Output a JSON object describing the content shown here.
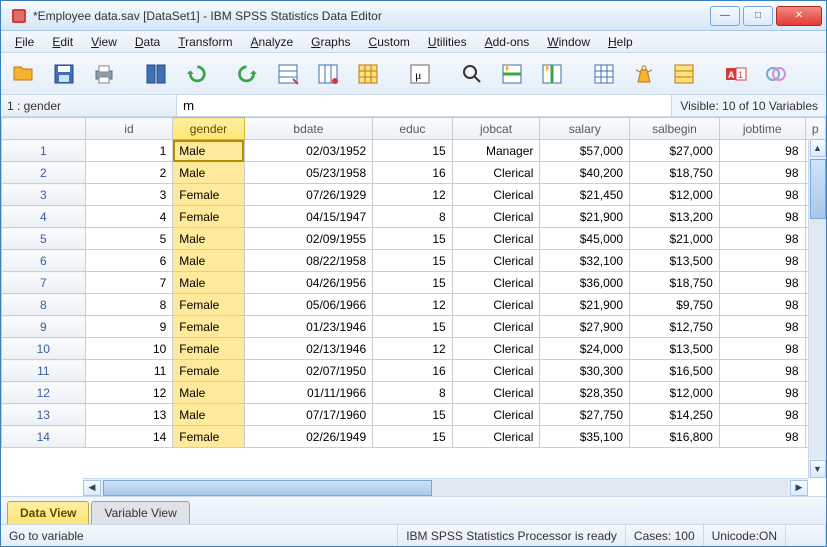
{
  "window": {
    "title": "*Employee data.sav [DataSet1] - IBM SPSS Statistics Data Editor"
  },
  "menu": [
    "File",
    "Edit",
    "View",
    "Data",
    "Transform",
    "Analyze",
    "Graphs",
    "Custom",
    "Utilities",
    "Add-ons",
    "Window",
    "Help"
  ],
  "toolbar_icons": [
    "open",
    "save",
    "print",
    "recall",
    "undo",
    "redo",
    "gotocase",
    "gotovariable",
    "variables",
    "run",
    "find",
    "insertcase",
    "insertvariable",
    "splitfile",
    "weight",
    "selectcases",
    "valuelabels",
    "usevarsets"
  ],
  "editbar": {
    "cellref": "1 : gender",
    "value": "m",
    "visible_label": "Visible: 10 of 10 Variables"
  },
  "grid": {
    "columns": [
      "id",
      "gender",
      "bdate",
      "educ",
      "jobcat",
      "salary",
      "salbegin",
      "jobtime",
      "p"
    ],
    "selected_column": "gender",
    "rows": [
      {
        "n": 1,
        "id": "1",
        "gender": "Male",
        "bdate": "02/03/1952",
        "educ": "15",
        "jobcat": "Manager",
        "salary": "$57,000",
        "salbegin": "$27,000",
        "jobtime": "98"
      },
      {
        "n": 2,
        "id": "2",
        "gender": "Male",
        "bdate": "05/23/1958",
        "educ": "16",
        "jobcat": "Clerical",
        "salary": "$40,200",
        "salbegin": "$18,750",
        "jobtime": "98"
      },
      {
        "n": 3,
        "id": "3",
        "gender": "Female",
        "bdate": "07/26/1929",
        "educ": "12",
        "jobcat": "Clerical",
        "salary": "$21,450",
        "salbegin": "$12,000",
        "jobtime": "98"
      },
      {
        "n": 4,
        "id": "4",
        "gender": "Female",
        "bdate": "04/15/1947",
        "educ": "8",
        "jobcat": "Clerical",
        "salary": "$21,900",
        "salbegin": "$13,200",
        "jobtime": "98"
      },
      {
        "n": 5,
        "id": "5",
        "gender": "Male",
        "bdate": "02/09/1955",
        "educ": "15",
        "jobcat": "Clerical",
        "salary": "$45,000",
        "salbegin": "$21,000",
        "jobtime": "98"
      },
      {
        "n": 6,
        "id": "6",
        "gender": "Male",
        "bdate": "08/22/1958",
        "educ": "15",
        "jobcat": "Clerical",
        "salary": "$32,100",
        "salbegin": "$13,500",
        "jobtime": "98"
      },
      {
        "n": 7,
        "id": "7",
        "gender": "Male",
        "bdate": "04/26/1956",
        "educ": "15",
        "jobcat": "Clerical",
        "salary": "$36,000",
        "salbegin": "$18,750",
        "jobtime": "98"
      },
      {
        "n": 8,
        "id": "8",
        "gender": "Female",
        "bdate": "05/06/1966",
        "educ": "12",
        "jobcat": "Clerical",
        "salary": "$21,900",
        "salbegin": "$9,750",
        "jobtime": "98"
      },
      {
        "n": 9,
        "id": "9",
        "gender": "Female",
        "bdate": "01/23/1946",
        "educ": "15",
        "jobcat": "Clerical",
        "salary": "$27,900",
        "salbegin": "$12,750",
        "jobtime": "98"
      },
      {
        "n": 10,
        "id": "10",
        "gender": "Female",
        "bdate": "02/13/1946",
        "educ": "12",
        "jobcat": "Clerical",
        "salary": "$24,000",
        "salbegin": "$13,500",
        "jobtime": "98"
      },
      {
        "n": 11,
        "id": "11",
        "gender": "Female",
        "bdate": "02/07/1950",
        "educ": "16",
        "jobcat": "Clerical",
        "salary": "$30,300",
        "salbegin": "$16,500",
        "jobtime": "98"
      },
      {
        "n": 12,
        "id": "12",
        "gender": "Male",
        "bdate": "01/11/1966",
        "educ": "8",
        "jobcat": "Clerical",
        "salary": "$28,350",
        "salbegin": "$12,000",
        "jobtime": "98"
      },
      {
        "n": 13,
        "id": "13",
        "gender": "Male",
        "bdate": "07/17/1960",
        "educ": "15",
        "jobcat": "Clerical",
        "salary": "$27,750",
        "salbegin": "$14,250",
        "jobtime": "98"
      },
      {
        "n": 14,
        "id": "14",
        "gender": "Female",
        "bdate": "02/26/1949",
        "educ": "15",
        "jobcat": "Clerical",
        "salary": "$35,100",
        "salbegin": "$16,800",
        "jobtime": "98"
      }
    ]
  },
  "tabs": {
    "data_view": "Data View",
    "variable_view": "Variable View"
  },
  "status": {
    "left": "Go to variable",
    "processor": "IBM SPSS Statistics Processor is ready",
    "cases": "Cases: 100",
    "unicode": "Unicode:ON"
  }
}
